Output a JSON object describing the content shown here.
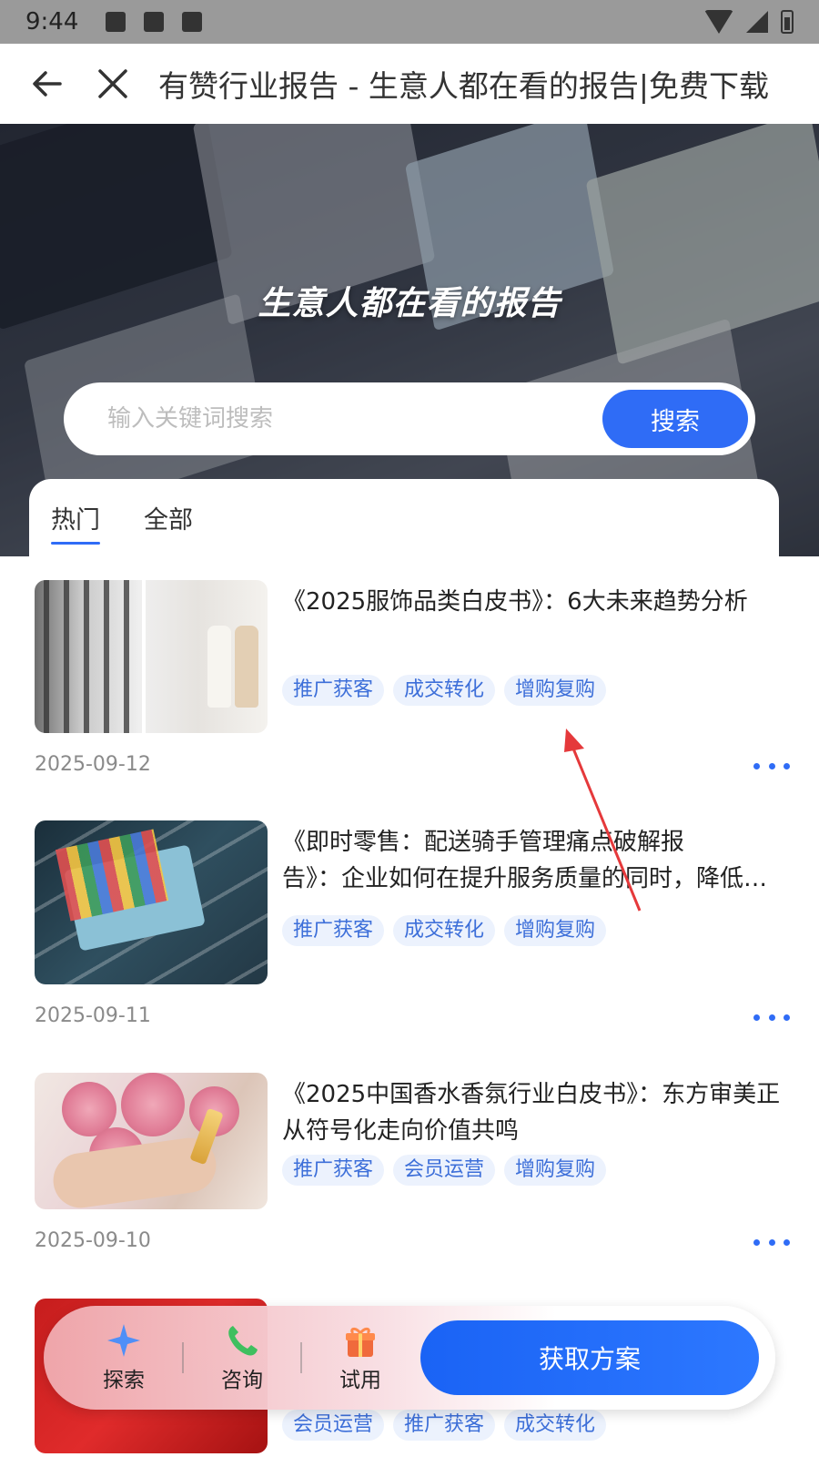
{
  "status_bar": {
    "time": "9:44"
  },
  "nav": {
    "title": "有赞行业报告 - 生意人都在看的报告|免费下载"
  },
  "hero": {
    "title": "生意人都在看的报告"
  },
  "search": {
    "placeholder": "输入关键词搜索",
    "button_label": "搜索"
  },
  "tabs": [
    {
      "label": "热门",
      "active": true
    },
    {
      "label": "全部",
      "active": false
    }
  ],
  "reports": [
    {
      "title": "《2025服饰品类白皮书》：6大未来趋势分析",
      "tags": [
        "推广获客",
        "成交转化",
        "增购复购"
      ],
      "date": "2025-09-12"
    },
    {
      "title_line1": "《即时零售：配送骑手管理痛点破解报",
      "title_line2": "告》：企业如何在提升服务质量的同时，降低成本",
      "tags": [
        "推广获客",
        "成交转化",
        "增购复购"
      ],
      "date": "2025-09-11"
    },
    {
      "title": "《2025中国香水香氛行业白皮书》：东方审美正从符号化走向价值共鸣",
      "tags": [
        "推广获客",
        "会员运营",
        "增购复购"
      ],
      "date": "2025-09-10"
    },
    {
      "tags": [
        "会员运营",
        "推广获客",
        "成交转化"
      ]
    }
  ],
  "bottom_bar": {
    "items": [
      {
        "label": "探索",
        "icon": "sparkle-icon"
      },
      {
        "label": "咨询",
        "icon": "phone-icon"
      },
      {
        "label": "试用",
        "icon": "gift-icon"
      }
    ],
    "cta_label": "获取方案"
  },
  "colors": {
    "accent": "#2f6cf6",
    "tag_bg": "#ecf2fd",
    "tag_text": "#3d6fd9",
    "annotation": "#e5393b"
  }
}
